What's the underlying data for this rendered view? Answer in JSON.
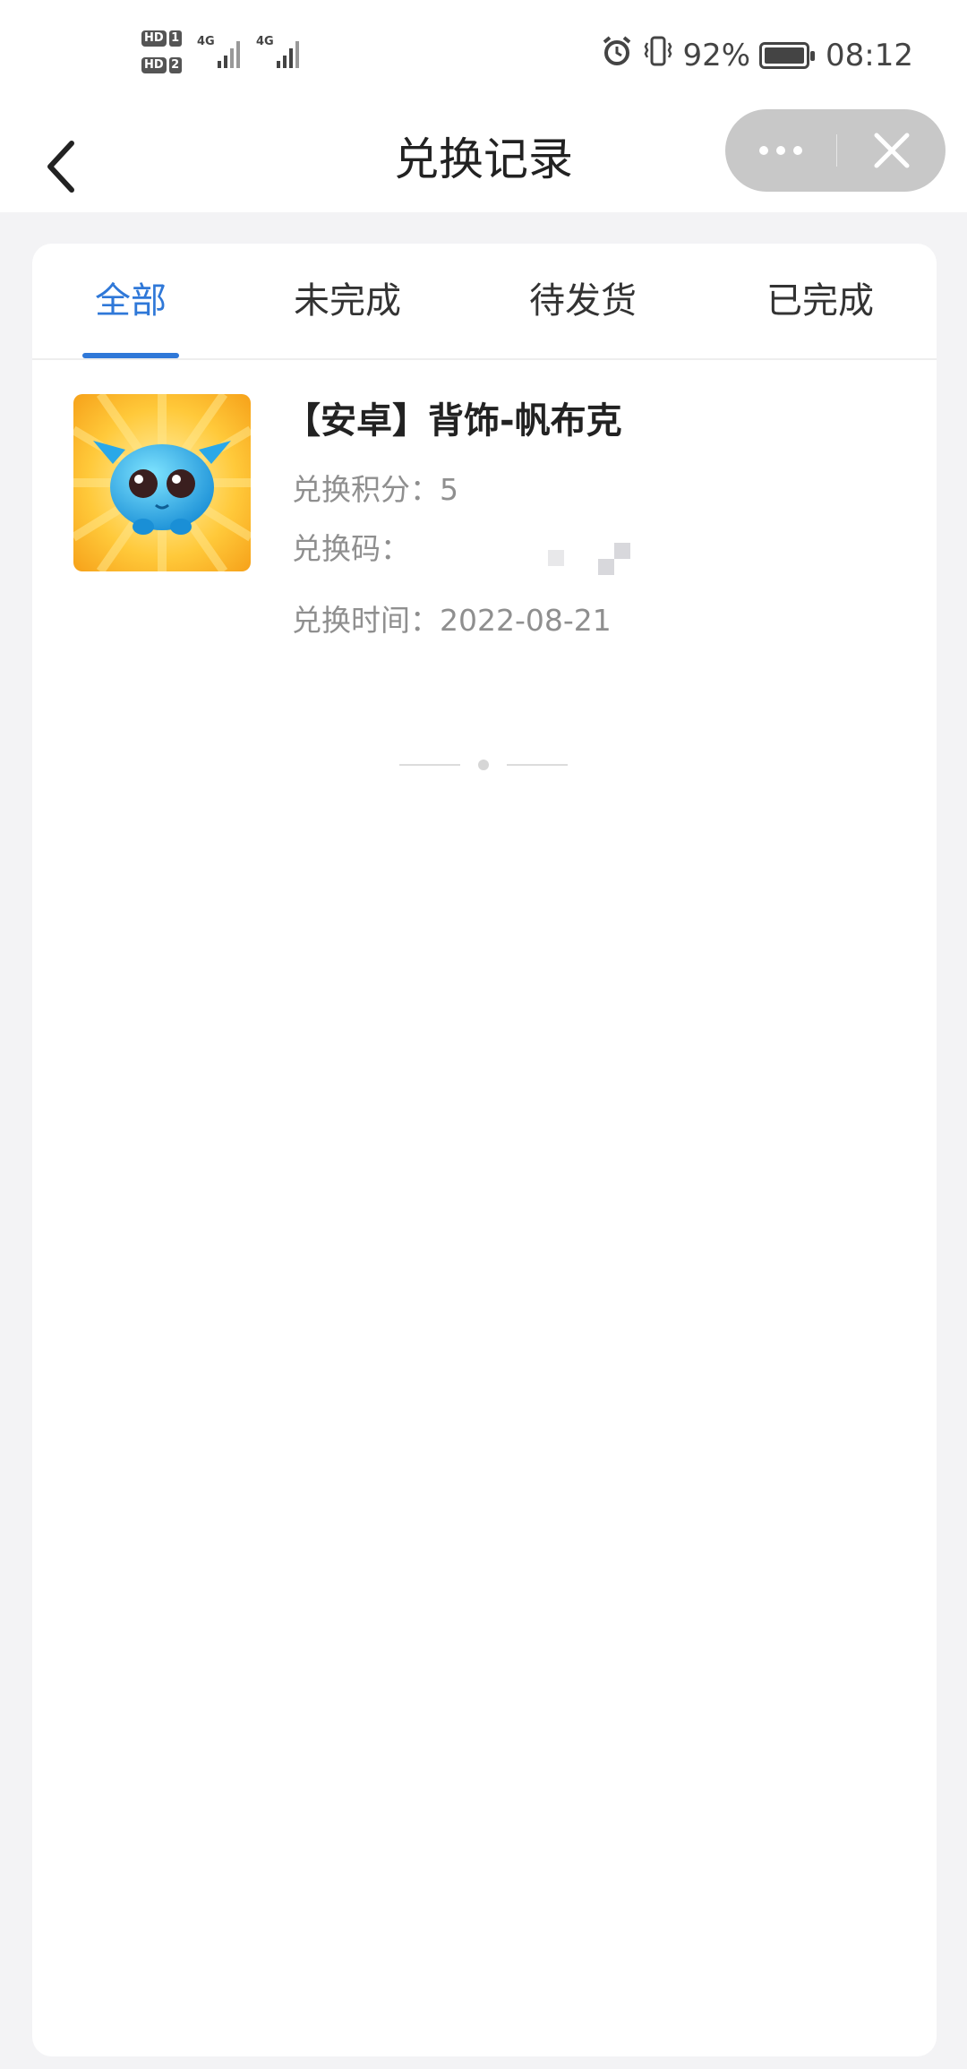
{
  "status_bar": {
    "sim1": "HD",
    "sim1_num": "1",
    "sim2": "HD",
    "sim2_num": "2",
    "net1": "4G",
    "net2": "4G",
    "battery_percent": "92%",
    "time": "08:12",
    "icons": [
      "alarm-icon",
      "vibrate-icon",
      "battery-icon"
    ]
  },
  "nav": {
    "title": "兑换记录",
    "back_icon": "chevron-left-icon",
    "more_icon": "more-dots-icon",
    "close_icon": "close-icon"
  },
  "tabs": [
    {
      "label": "全部",
      "active": true
    },
    {
      "label": "未完成",
      "active": false
    },
    {
      "label": "待发货",
      "active": false
    },
    {
      "label": "已完成",
      "active": false
    }
  ],
  "records": [
    {
      "title": "【安卓】背饰-帆布克",
      "points_label": "兑换积分：",
      "points_value": "5",
      "code_label": "兑换码：",
      "code_value": "",
      "time_label": "兑换时间：",
      "time_value": "2022-08-21"
    }
  ],
  "colors": {
    "accent": "#2f78d8",
    "background": "#f3f3f5",
    "card": "#ffffff",
    "muted_text": "#8f8f8f"
  }
}
